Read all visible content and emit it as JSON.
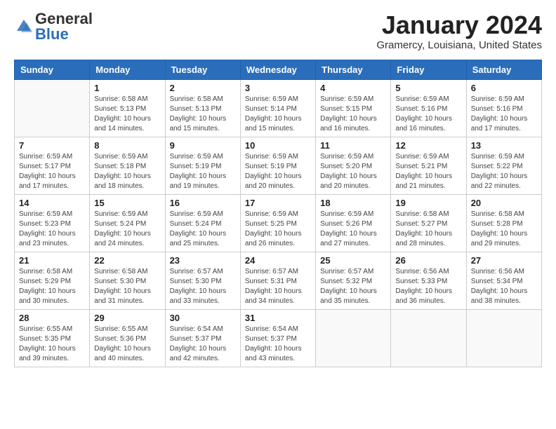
{
  "header": {
    "logo_general": "General",
    "logo_blue": "Blue",
    "month_title": "January 2024",
    "location": "Gramercy, Louisiana, United States"
  },
  "days_of_week": [
    "Sunday",
    "Monday",
    "Tuesday",
    "Wednesday",
    "Thursday",
    "Friday",
    "Saturday"
  ],
  "weeks": [
    [
      {
        "day": "",
        "info": ""
      },
      {
        "day": "1",
        "info": "Sunrise: 6:58 AM\nSunset: 5:13 PM\nDaylight: 10 hours\nand 14 minutes."
      },
      {
        "day": "2",
        "info": "Sunrise: 6:58 AM\nSunset: 5:13 PM\nDaylight: 10 hours\nand 15 minutes."
      },
      {
        "day": "3",
        "info": "Sunrise: 6:59 AM\nSunset: 5:14 PM\nDaylight: 10 hours\nand 15 minutes."
      },
      {
        "day": "4",
        "info": "Sunrise: 6:59 AM\nSunset: 5:15 PM\nDaylight: 10 hours\nand 16 minutes."
      },
      {
        "day": "5",
        "info": "Sunrise: 6:59 AM\nSunset: 5:16 PM\nDaylight: 10 hours\nand 16 minutes."
      },
      {
        "day": "6",
        "info": "Sunrise: 6:59 AM\nSunset: 5:16 PM\nDaylight: 10 hours\nand 17 minutes."
      }
    ],
    [
      {
        "day": "7",
        "info": "Sunrise: 6:59 AM\nSunset: 5:17 PM\nDaylight: 10 hours\nand 17 minutes."
      },
      {
        "day": "8",
        "info": "Sunrise: 6:59 AM\nSunset: 5:18 PM\nDaylight: 10 hours\nand 18 minutes."
      },
      {
        "day": "9",
        "info": "Sunrise: 6:59 AM\nSunset: 5:19 PM\nDaylight: 10 hours\nand 19 minutes."
      },
      {
        "day": "10",
        "info": "Sunrise: 6:59 AM\nSunset: 5:19 PM\nDaylight: 10 hours\nand 20 minutes."
      },
      {
        "day": "11",
        "info": "Sunrise: 6:59 AM\nSunset: 5:20 PM\nDaylight: 10 hours\nand 20 minutes."
      },
      {
        "day": "12",
        "info": "Sunrise: 6:59 AM\nSunset: 5:21 PM\nDaylight: 10 hours\nand 21 minutes."
      },
      {
        "day": "13",
        "info": "Sunrise: 6:59 AM\nSunset: 5:22 PM\nDaylight: 10 hours\nand 22 minutes."
      }
    ],
    [
      {
        "day": "14",
        "info": "Sunrise: 6:59 AM\nSunset: 5:23 PM\nDaylight: 10 hours\nand 23 minutes."
      },
      {
        "day": "15",
        "info": "Sunrise: 6:59 AM\nSunset: 5:24 PM\nDaylight: 10 hours\nand 24 minutes."
      },
      {
        "day": "16",
        "info": "Sunrise: 6:59 AM\nSunset: 5:24 PM\nDaylight: 10 hours\nand 25 minutes."
      },
      {
        "day": "17",
        "info": "Sunrise: 6:59 AM\nSunset: 5:25 PM\nDaylight: 10 hours\nand 26 minutes."
      },
      {
        "day": "18",
        "info": "Sunrise: 6:59 AM\nSunset: 5:26 PM\nDaylight: 10 hours\nand 27 minutes."
      },
      {
        "day": "19",
        "info": "Sunrise: 6:58 AM\nSunset: 5:27 PM\nDaylight: 10 hours\nand 28 minutes."
      },
      {
        "day": "20",
        "info": "Sunrise: 6:58 AM\nSunset: 5:28 PM\nDaylight: 10 hours\nand 29 minutes."
      }
    ],
    [
      {
        "day": "21",
        "info": "Sunrise: 6:58 AM\nSunset: 5:29 PM\nDaylight: 10 hours\nand 30 minutes."
      },
      {
        "day": "22",
        "info": "Sunrise: 6:58 AM\nSunset: 5:30 PM\nDaylight: 10 hours\nand 31 minutes."
      },
      {
        "day": "23",
        "info": "Sunrise: 6:57 AM\nSunset: 5:30 PM\nDaylight: 10 hours\nand 33 minutes."
      },
      {
        "day": "24",
        "info": "Sunrise: 6:57 AM\nSunset: 5:31 PM\nDaylight: 10 hours\nand 34 minutes."
      },
      {
        "day": "25",
        "info": "Sunrise: 6:57 AM\nSunset: 5:32 PM\nDaylight: 10 hours\nand 35 minutes."
      },
      {
        "day": "26",
        "info": "Sunrise: 6:56 AM\nSunset: 5:33 PM\nDaylight: 10 hours\nand 36 minutes."
      },
      {
        "day": "27",
        "info": "Sunrise: 6:56 AM\nSunset: 5:34 PM\nDaylight: 10 hours\nand 38 minutes."
      }
    ],
    [
      {
        "day": "28",
        "info": "Sunrise: 6:55 AM\nSunset: 5:35 PM\nDaylight: 10 hours\nand 39 minutes."
      },
      {
        "day": "29",
        "info": "Sunrise: 6:55 AM\nSunset: 5:36 PM\nDaylight: 10 hours\nand 40 minutes."
      },
      {
        "day": "30",
        "info": "Sunrise: 6:54 AM\nSunset: 5:37 PM\nDaylight: 10 hours\nand 42 minutes."
      },
      {
        "day": "31",
        "info": "Sunrise: 6:54 AM\nSunset: 5:37 PM\nDaylight: 10 hours\nand 43 minutes."
      },
      {
        "day": "",
        "info": ""
      },
      {
        "day": "",
        "info": ""
      },
      {
        "day": "",
        "info": ""
      }
    ]
  ]
}
